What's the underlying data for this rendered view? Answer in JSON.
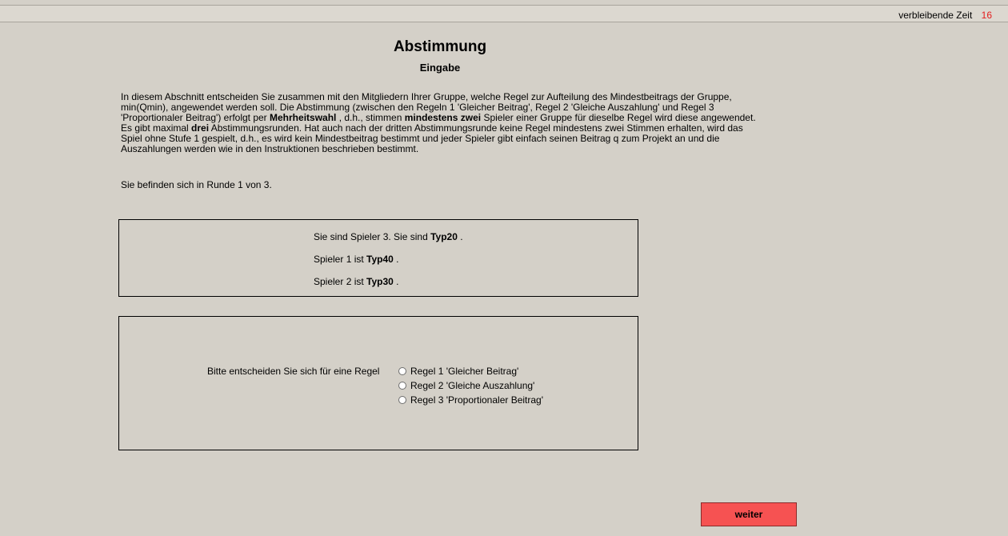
{
  "timer": {
    "label": "verbleibende Zeit",
    "value": "16"
  },
  "header": {
    "title": "Abstimmung",
    "subtitle": "Eingabe"
  },
  "intro": {
    "t1": "In diesem Abschnitt entscheiden Sie zusammen mit den Mitgliedern Ihrer Gruppe, welche Regel zur Aufteilung des Mindestbeitrags der Gruppe, min(Qmin), angewendet werden soll. Die Abstimmung (zwischen den Regeln 1 'Gleicher Beitrag', Regel 2 'Gleiche Auszahlung' und Regel 3 'Proportionaler Beitrag') erfolgt per ",
    "b1": "Mehrheitswahl",
    "t2": " , d.h., stimmen ",
    "b2": "mindestens zwei",
    "t3": " Spieler einer Gruppe für dieselbe Regel wird diese angewendet. Es gibt maximal ",
    "b3": "drei",
    "t4": " Abstimmungsrunden. Hat auch nach der dritten Abstimmungsrunde keine Regel mindestens zwei Stimmen erhalten, wird das Spiel ohne Stufe 1 gespielt, d.h., es wird kein Mindestbeitrag bestimmt und jeder Spieler gibt einfach seinen Beitrag q zum Projekt an und die Auszahlungen werden wie in den Instruktionen beschrieben bestimmt."
  },
  "round_text": "Sie befinden sich in Runde 1 von 3.",
  "players": {
    "self_text": "Sie sind Spieler 3. Sie sind ",
    "self_type": "Typ20",
    "p1_text": "Spieler 1 ist ",
    "p1_type": "Typ40",
    "p2_text": "Spieler 2 ist ",
    "p2_type": "Typ30",
    "suffix": " ."
  },
  "vote": {
    "label": "Bitte entscheiden Sie sich für eine Regel",
    "options": [
      "Regel 1 'Gleicher Beitrag'",
      "Regel 2 'Gleiche Auszahlung'",
      "Regel 3 'Proportionaler Beitrag'"
    ]
  },
  "next_button": "weiter"
}
